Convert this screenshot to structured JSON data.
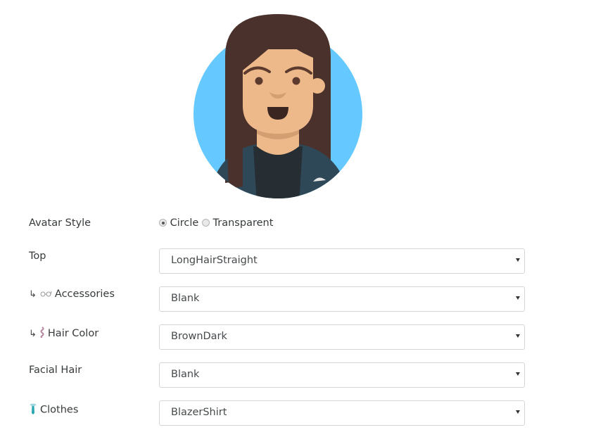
{
  "avatar": {
    "colors": {
      "background": "#65C9FF",
      "hair": "#4A312C",
      "skin": "#EDB98A",
      "blazer": "#2F4858",
      "shirt": "#262E33",
      "features": "#5C3B2E",
      "mouth": "#3B2520"
    }
  },
  "form": {
    "avatar_style": {
      "label": "Avatar Style",
      "options": [
        {
          "label": "Circle",
          "checked": true
        },
        {
          "label": "Transparent",
          "checked": false
        }
      ]
    },
    "fields": [
      {
        "id": "top",
        "prefix": "",
        "icon": "",
        "label": "Top",
        "value": "LongHairStraight"
      },
      {
        "id": "accessories",
        "prefix": "↳",
        "icon": "glasses-icon",
        "label": "Accessories",
        "value": "Blank"
      },
      {
        "id": "hair-color",
        "prefix": "↳",
        "icon": "hair-strand-icon",
        "label": "Hair Color",
        "value": "BrownDark"
      },
      {
        "id": "facial-hair",
        "prefix": "",
        "icon": "",
        "label": "Facial Hair",
        "value": "Blank"
      },
      {
        "id": "clothes",
        "prefix": "",
        "icon": "tie-icon",
        "label": "Clothes",
        "value": "BlazerShirt"
      }
    ]
  }
}
